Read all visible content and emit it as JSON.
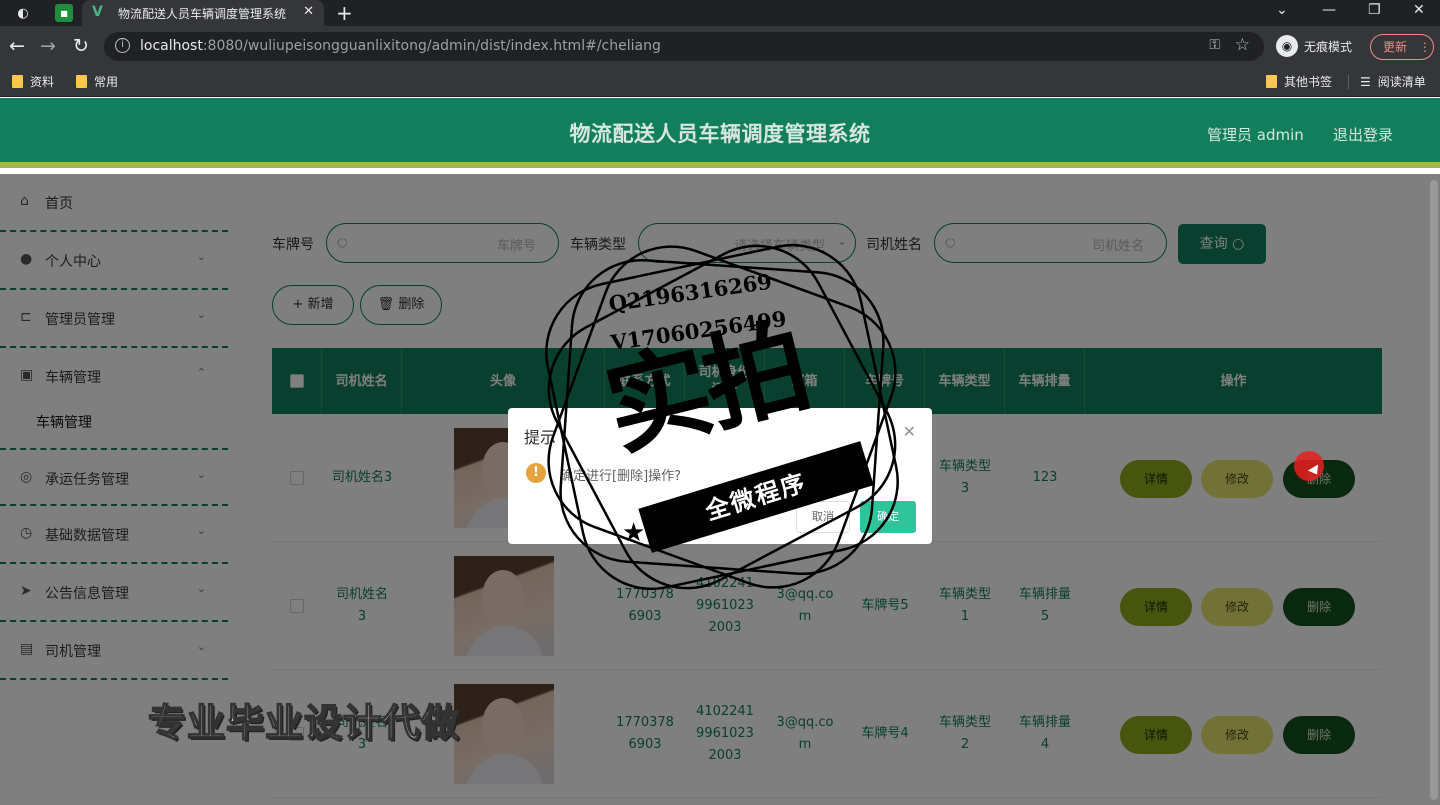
{
  "browser": {
    "tab_title": "物流配送人员车辆调度管理系统",
    "url_host": "localhost",
    "url_rest": ":8080/wuliupeisongguanlixitong/admin/dist/index.html#/cheliang",
    "incognito_label": "无痕模式",
    "update_label": "更新",
    "bookmarks": [
      "资料",
      "常用"
    ],
    "other_bookmarks": "其他书签",
    "reading_list": "阅读清单"
  },
  "header": {
    "title": "物流配送人员车辆调度管理系统",
    "user": "管理员 admin",
    "logout": "退出登录"
  },
  "sidebar": {
    "items": [
      {
        "label": "首页",
        "icon": "home-icon"
      },
      {
        "label": "个人中心",
        "icon": "user-icon"
      },
      {
        "label": "管理员管理",
        "icon": "crop-icon"
      },
      {
        "label": "车辆管理",
        "icon": "car-icon"
      },
      {
        "label": "承运任务管理",
        "icon": "globe-icon"
      },
      {
        "label": "基础数据管理",
        "icon": "compass-icon"
      },
      {
        "label": "公告信息管理",
        "icon": "send-icon"
      },
      {
        "label": "司机管理",
        "icon": "doc-icon"
      }
    ],
    "submenu_label": "车辆管理"
  },
  "search": {
    "plate_label": "车牌号",
    "plate_placeholder": "车牌号",
    "type_label": "车辆类型",
    "type_placeholder": "请选择车辆类型",
    "driver_label": "司机姓名",
    "driver_placeholder": "司机姓名",
    "query_button": "查询"
  },
  "actions": {
    "add": "+ 新增",
    "delete": "删除"
  },
  "table": {
    "headers": [
      "司机姓名",
      "头像",
      "联系方式",
      "司机身份证号",
      "邮箱",
      "车牌号",
      "车辆类型",
      "车辆排量",
      "操作"
    ],
    "rows": [
      {
        "driver": "司机姓名3",
        "phone": "",
        "idcard": "",
        "email": "",
        "plate": "",
        "type": "车辆类型3",
        "displacement": "123"
      },
      {
        "driver": "司机姓名3",
        "phone": "17703786903",
        "idcard": "410224199610232003",
        "email": "3@qq.com",
        "plate": "车牌号5",
        "type": "车辆类型1",
        "displacement": "车辆排量5"
      },
      {
        "driver": "司机姓名3",
        "phone": "17703786903",
        "idcard": "410224199610232003",
        "email": "3@qq.com",
        "plate": "车牌号4",
        "type": "车辆类型2",
        "displacement": "车辆排量4"
      }
    ],
    "ops": {
      "detail": "详情",
      "edit": "修改",
      "delete": "删除"
    }
  },
  "dialog": {
    "title": "提示",
    "message": "确定进行[删除]操作?",
    "cancel": "取消",
    "confirm": "确定"
  },
  "watermark": {
    "qq": "Q2196316269",
    "vx": "V17060256499",
    "big": "实拍",
    "ribbon": "全微程序",
    "bottom": "专业毕业设计代做"
  }
}
